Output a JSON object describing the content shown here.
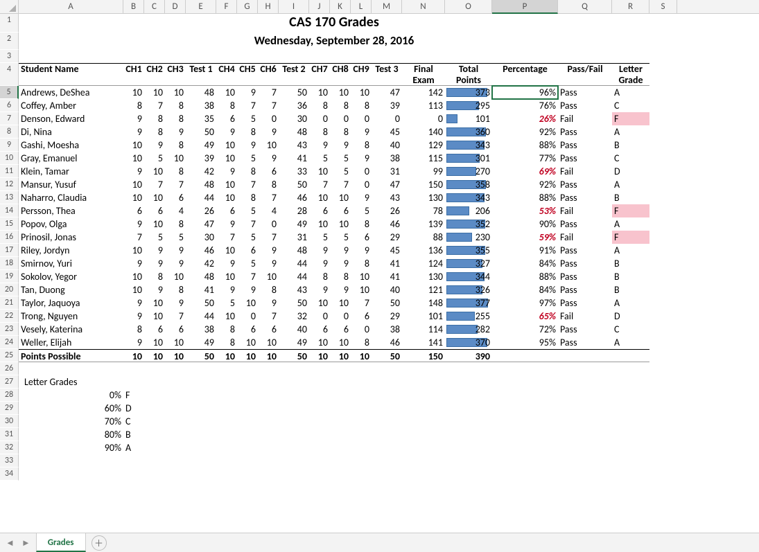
{
  "title": "CAS 170 Grades",
  "subtitle": "Wednesday, September 28, 2016",
  "cols": [
    "A",
    "B",
    "C",
    "D",
    "E",
    "F",
    "G",
    "H",
    "I",
    "J",
    "K",
    "L",
    "M",
    "N",
    "O",
    "P",
    "Q",
    "R",
    "S"
  ],
  "active_col": "P",
  "active_row": 5,
  "headers": {
    "A": "Student Name",
    "B": "CH1",
    "C": "CH2",
    "D": "CH3",
    "E": "Test 1",
    "F": "CH4",
    "G": "CH5",
    "H": "CH6",
    "I": "Test 2",
    "J": "CH7",
    "K": "CH8",
    "L": "CH9",
    "M": "Test 3",
    "N": "Final Exam",
    "O": "Total Points",
    "P": "Percentage",
    "Q": "Pass/Fail",
    "R": "Letter Grade"
  },
  "max_points": 390,
  "students": [
    {
      "name": "Andrews, DeShea",
      "ch1": 10,
      "ch2": 10,
      "ch3": 10,
      "t1": 48,
      "ch4": 10,
      "ch5": 9,
      "ch6": 7,
      "t2": 50,
      "ch7": 10,
      "ch8": 10,
      "ch9": 10,
      "t3": 47,
      "final": 142,
      "total": 373,
      "pct": "96%",
      "pf": "Pass",
      "lg": "A"
    },
    {
      "name": "Coffey, Amber",
      "ch1": 8,
      "ch2": 7,
      "ch3": 8,
      "t1": 38,
      "ch4": 8,
      "ch5": 7,
      "ch6": 7,
      "t2": 36,
      "ch7": 8,
      "ch8": 8,
      "ch9": 8,
      "t3": 39,
      "final": 113,
      "total": 295,
      "pct": "76%",
      "pf": "Pass",
      "lg": "C"
    },
    {
      "name": "Denson, Edward",
      "ch1": 9,
      "ch2": 8,
      "ch3": 8,
      "t1": 35,
      "ch4": 6,
      "ch5": 5,
      "ch6": 0,
      "t2": 30,
      "ch7": 0,
      "ch8": 0,
      "ch9": 0,
      "t3": 0,
      "final": 0,
      "total": 101,
      "pct": "26%",
      "pf": "Fail",
      "lg": "F"
    },
    {
      "name": "Di, Nina",
      "ch1": 9,
      "ch2": 8,
      "ch3": 9,
      "t1": 50,
      "ch4": 9,
      "ch5": 8,
      "ch6": 9,
      "t2": 48,
      "ch7": 8,
      "ch8": 8,
      "ch9": 9,
      "t3": 45,
      "final": 140,
      "total": 360,
      "pct": "92%",
      "pf": "Pass",
      "lg": "A"
    },
    {
      "name": "Gashi, Moesha",
      "ch1": 10,
      "ch2": 9,
      "ch3": 8,
      "t1": 49,
      "ch4": 10,
      "ch5": 9,
      "ch6": 10,
      "t2": 43,
      "ch7": 9,
      "ch8": 9,
      "ch9": 8,
      "t3": 40,
      "final": 129,
      "total": 343,
      "pct": "88%",
      "pf": "Pass",
      "lg": "B"
    },
    {
      "name": "Gray, Emanuel",
      "ch1": 10,
      "ch2": 5,
      "ch3": 10,
      "t1": 39,
      "ch4": 10,
      "ch5": 5,
      "ch6": 9,
      "t2": 41,
      "ch7": 5,
      "ch8": 5,
      "ch9": 9,
      "t3": 38,
      "final": 115,
      "total": 301,
      "pct": "77%",
      "pf": "Pass",
      "lg": "C"
    },
    {
      "name": "Klein, Tamar",
      "ch1": 9,
      "ch2": 10,
      "ch3": 8,
      "t1": 42,
      "ch4": 9,
      "ch5": 8,
      "ch6": 6,
      "t2": 33,
      "ch7": 10,
      "ch8": 5,
      "ch9": 0,
      "t3": 31,
      "final": 99,
      "total": 270,
      "pct": "69%",
      "pf": "Fail",
      "lg": "D"
    },
    {
      "name": "Mansur, Yusuf",
      "ch1": 10,
      "ch2": 7,
      "ch3": 7,
      "t1": 48,
      "ch4": 10,
      "ch5": 7,
      "ch6": 8,
      "t2": 50,
      "ch7": 7,
      "ch8": 7,
      "ch9": 0,
      "t3": 47,
      "final": 150,
      "total": 358,
      "pct": "92%",
      "pf": "Pass",
      "lg": "A"
    },
    {
      "name": "Naharro, Claudia",
      "ch1": 10,
      "ch2": 10,
      "ch3": 6,
      "t1": 44,
      "ch4": 10,
      "ch5": 8,
      "ch6": 7,
      "t2": 46,
      "ch7": 10,
      "ch8": 10,
      "ch9": 9,
      "t3": 43,
      "final": 130,
      "total": 343,
      "pct": "88%",
      "pf": "Pass",
      "lg": "B"
    },
    {
      "name": "Persson, Thea",
      "ch1": 6,
      "ch2": 6,
      "ch3": 4,
      "t1": 26,
      "ch4": 6,
      "ch5": 5,
      "ch6": 4,
      "t2": 28,
      "ch7": 6,
      "ch8": 6,
      "ch9": 5,
      "t3": 26,
      "final": 78,
      "total": 206,
      "pct": "53%",
      "pf": "Fail",
      "lg": "F"
    },
    {
      "name": "Popov, Olga",
      "ch1": 9,
      "ch2": 10,
      "ch3": 8,
      "t1": 47,
      "ch4": 9,
      "ch5": 7,
      "ch6": 0,
      "t2": 49,
      "ch7": 10,
      "ch8": 10,
      "ch9": 8,
      "t3": 46,
      "final": 139,
      "total": 352,
      "pct": "90%",
      "pf": "Pass",
      "lg": "A"
    },
    {
      "name": "Prinosil, Jonas",
      "ch1": 7,
      "ch2": 5,
      "ch3": 5,
      "t1": 30,
      "ch4": 7,
      "ch5": 5,
      "ch6": 7,
      "t2": 31,
      "ch7": 5,
      "ch8": 5,
      "ch9": 6,
      "t3": 29,
      "final": 88,
      "total": 230,
      "pct": "59%",
      "pf": "Fail",
      "lg": "F"
    },
    {
      "name": "Riley, Jordyn",
      "ch1": 10,
      "ch2": 9,
      "ch3": 9,
      "t1": 46,
      "ch4": 10,
      "ch5": 6,
      "ch6": 9,
      "t2": 48,
      "ch7": 9,
      "ch8": 9,
      "ch9": 9,
      "t3": 45,
      "final": 136,
      "total": 355,
      "pct": "91%",
      "pf": "Pass",
      "lg": "A"
    },
    {
      "name": "Smirnov, Yuri",
      "ch1": 9,
      "ch2": 9,
      "ch3": 9,
      "t1": 42,
      "ch4": 9,
      "ch5": 5,
      "ch6": 9,
      "t2": 44,
      "ch7": 9,
      "ch8": 9,
      "ch9": 8,
      "t3": 41,
      "final": 124,
      "total": 327,
      "pct": "84%",
      "pf": "Pass",
      "lg": "B"
    },
    {
      "name": "Sokolov, Yegor",
      "ch1": 10,
      "ch2": 8,
      "ch3": 10,
      "t1": 48,
      "ch4": 10,
      "ch5": 7,
      "ch6": 10,
      "t2": 44,
      "ch7": 8,
      "ch8": 8,
      "ch9": 10,
      "t3": 41,
      "final": 130,
      "total": 344,
      "pct": "88%",
      "pf": "Pass",
      "lg": "B"
    },
    {
      "name": "Tan, Duong",
      "ch1": 10,
      "ch2": 9,
      "ch3": 8,
      "t1": 41,
      "ch4": 9,
      "ch5": 9,
      "ch6": 8,
      "t2": 43,
      "ch7": 9,
      "ch8": 9,
      "ch9": 10,
      "t3": 40,
      "final": 121,
      "total": 326,
      "pct": "84%",
      "pf": "Pass",
      "lg": "B"
    },
    {
      "name": "Taylor, Jaquoya",
      "ch1": 9,
      "ch2": 10,
      "ch3": 9,
      "t1": 50,
      "ch4": 5,
      "ch5": 10,
      "ch6": 9,
      "t2": 50,
      "ch7": 10,
      "ch8": 10,
      "ch9": 7,
      "t3": 50,
      "final": 148,
      "total": 377,
      "pct": "97%",
      "pf": "Pass",
      "lg": "A"
    },
    {
      "name": "Trong, Nguyen",
      "ch1": 9,
      "ch2": 10,
      "ch3": 7,
      "t1": 44,
      "ch4": 10,
      "ch5": 0,
      "ch6": 7,
      "t2": 32,
      "ch7": 0,
      "ch8": 0,
      "ch9": 6,
      "t3": 29,
      "final": 101,
      "total": 255,
      "pct": "65%",
      "pf": "Fail",
      "lg": "D"
    },
    {
      "name": "Vesely, Katerina",
      "ch1": 8,
      "ch2": 6,
      "ch3": 6,
      "t1": 38,
      "ch4": 8,
      "ch5": 6,
      "ch6": 6,
      "t2": 40,
      "ch7": 6,
      "ch8": 6,
      "ch9": 0,
      "t3": 38,
      "final": 114,
      "total": 282,
      "pct": "72%",
      "pf": "Pass",
      "lg": "C"
    },
    {
      "name": "Weller, Elijah",
      "ch1": 9,
      "ch2": 10,
      "ch3": 10,
      "t1": 49,
      "ch4": 8,
      "ch5": 10,
      "ch6": 10,
      "t2": 49,
      "ch7": 10,
      "ch8": 10,
      "ch9": 8,
      "t3": 46,
      "final": 141,
      "total": 370,
      "pct": "95%",
      "pf": "Pass",
      "lg": "A"
    }
  ],
  "points_possible": {
    "label": "Points Possible",
    "ch1": 10,
    "ch2": 10,
    "ch3": 10,
    "t1": 50,
    "ch4": 10,
    "ch5": 10,
    "ch6": 10,
    "t2": 50,
    "ch7": 10,
    "ch8": 10,
    "ch9": 10,
    "t3": 50,
    "final": 150,
    "total": 390
  },
  "letter_grades": {
    "title": "Letter Grades",
    "rows": [
      {
        "p": "0%",
        "g": "F"
      },
      {
        "p": "60%",
        "g": "D"
      },
      {
        "p": "70%",
        "g": "C"
      },
      {
        "p": "80%",
        "g": "B"
      },
      {
        "p": "90%",
        "g": "A"
      }
    ]
  },
  "tab": "Grades",
  "chart_data": {
    "type": "bar",
    "title": "Total Points (in-cell data bar, column O)",
    "xlabel": "Student",
    "ylabel": "Total Points",
    "ylim": [
      0,
      390
    ],
    "categories": [
      "Andrews, DeShea",
      "Coffey, Amber",
      "Denson, Edward",
      "Di, Nina",
      "Gashi, Moesha",
      "Gray, Emanuel",
      "Klein, Tamar",
      "Mansur, Yusuf",
      "Naharro, Claudia",
      "Persson, Thea",
      "Popov, Olga",
      "Prinosil, Jonas",
      "Riley, Jordyn",
      "Smirnov, Yuri",
      "Sokolov, Yegor",
      "Tan, Duong",
      "Taylor, Jaquoya",
      "Trong, Nguyen",
      "Vesely, Katerina",
      "Weller, Elijah"
    ],
    "values": [
      373,
      295,
      101,
      360,
      343,
      301,
      270,
      358,
      343,
      206,
      352,
      230,
      355,
      327,
      344,
      326,
      377,
      255,
      282,
      370
    ]
  }
}
